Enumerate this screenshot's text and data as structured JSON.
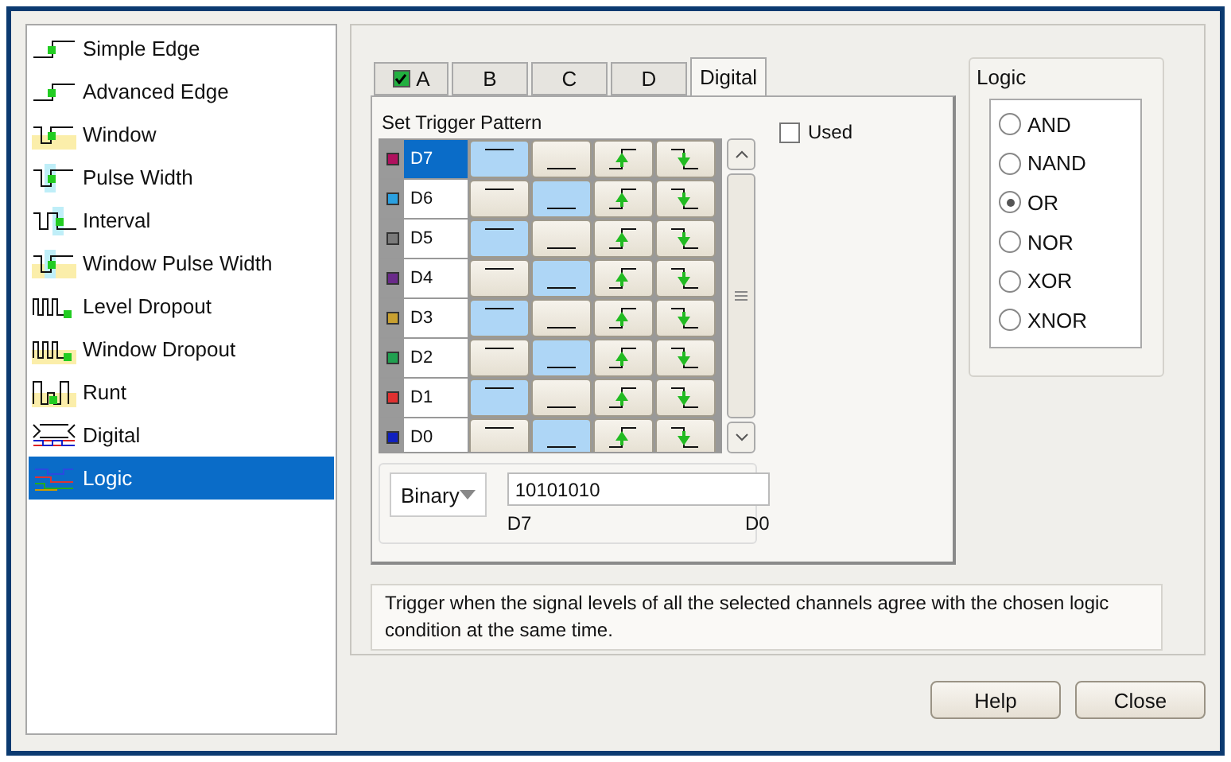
{
  "trigger_types": [
    {
      "label": "Simple Edge",
      "selected": false
    },
    {
      "label": "Advanced Edge",
      "selected": false
    },
    {
      "label": "Window",
      "selected": false
    },
    {
      "label": "Pulse Width",
      "selected": false
    },
    {
      "label": "Interval",
      "selected": false
    },
    {
      "label": "Window Pulse Width",
      "selected": false
    },
    {
      "label": "Level Dropout",
      "selected": false
    },
    {
      "label": "Window Dropout",
      "selected": false
    },
    {
      "label": "Runt",
      "selected": false
    },
    {
      "label": "Digital",
      "selected": false
    },
    {
      "label": "Logic",
      "selected": true
    }
  ],
  "tabs": [
    {
      "label": "A",
      "selected": false,
      "checked": true
    },
    {
      "label": "B",
      "selected": false
    },
    {
      "label": "C",
      "selected": false
    },
    {
      "label": "D",
      "selected": false
    },
    {
      "label": "Digital",
      "selected": true
    }
  ],
  "pattern": {
    "title": "Set Trigger Pattern",
    "used": {
      "label": "Used",
      "checked": false
    },
    "rows": [
      {
        "name": "D7",
        "color": "#b0105e",
        "selected": true,
        "high": true,
        "low": false
      },
      {
        "name": "D6",
        "color": "#2aa0e0",
        "selected": false,
        "high": false,
        "low": true
      },
      {
        "name": "D5",
        "color": "#7a7a7a",
        "selected": false,
        "high": true,
        "low": false
      },
      {
        "name": "D4",
        "color": "#6a2a8a",
        "selected": false,
        "high": false,
        "low": true
      },
      {
        "name": "D3",
        "color": "#c8a030",
        "selected": false,
        "high": true,
        "low": false
      },
      {
        "name": "D2",
        "color": "#20a050",
        "selected": false,
        "high": false,
        "low": true
      },
      {
        "name": "D1",
        "color": "#e03030",
        "selected": false,
        "high": true,
        "low": false
      },
      {
        "name": "D0",
        "color": "#1020c0",
        "selected": false,
        "high": false,
        "low": true
      }
    ],
    "format": "Binary",
    "value": "10101010",
    "msb_label": "D7",
    "lsb_label": "D0"
  },
  "logic": {
    "title": "Logic",
    "options": [
      {
        "label": "AND",
        "selected": false
      },
      {
        "label": "NAND",
        "selected": false
      },
      {
        "label": "OR",
        "selected": true
      },
      {
        "label": "NOR",
        "selected": false
      },
      {
        "label": "XOR",
        "selected": false
      },
      {
        "label": "XNOR",
        "selected": false
      }
    ]
  },
  "description": "Trigger when the signal levels of all the selected channels agree with the chosen logic condition at the same time.",
  "buttons": [
    "Help",
    "Close"
  ]
}
